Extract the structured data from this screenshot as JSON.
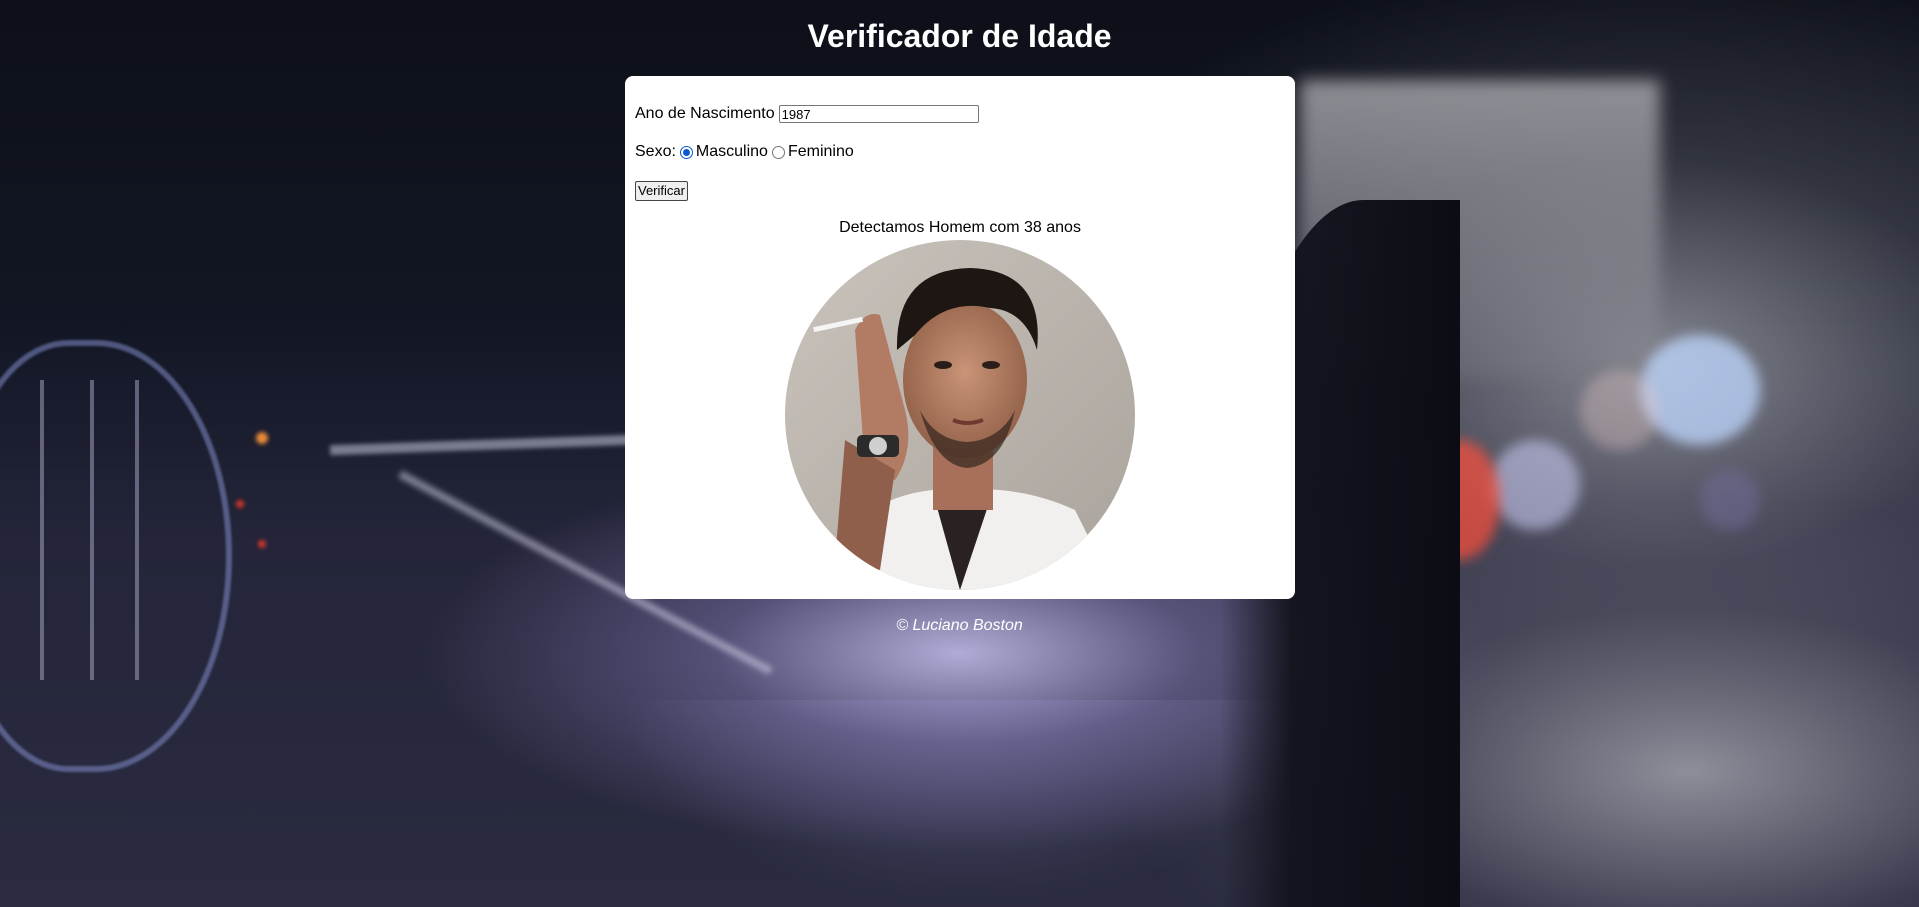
{
  "header": {
    "title": "Verificador de Idade"
  },
  "form": {
    "year_label": "Ano de Nascimento",
    "year_value": "1987",
    "sex_label": "Sexo:",
    "sex_options": [
      {
        "label": "Masculino",
        "selected": true
      },
      {
        "label": "Feminino",
        "selected": false
      }
    ],
    "verify_label": "Verificar"
  },
  "result": {
    "text": "Detectamos Homem com 38 anos",
    "image_subject": "man-portrait"
  },
  "footer": {
    "text": "© Luciano Boston"
  },
  "colors": {
    "radio_accent": "#0b57d0",
    "card_background": "#ffffff",
    "title_color": "#ffffff"
  }
}
